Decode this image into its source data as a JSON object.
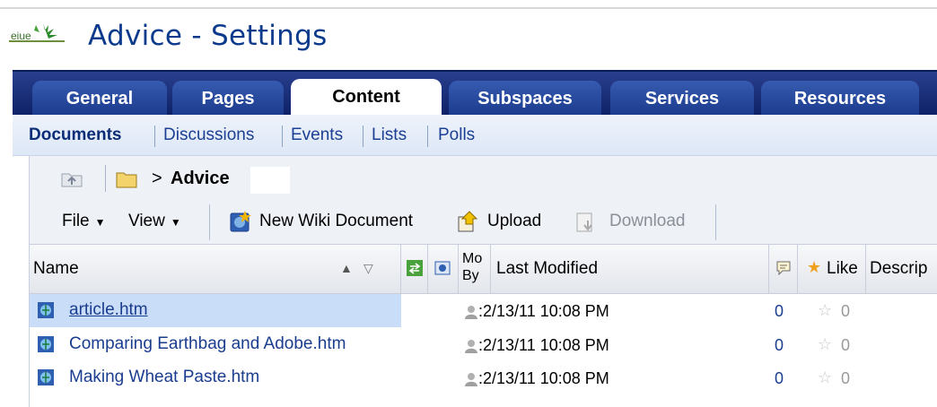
{
  "header": {
    "title": "Advice - Settings"
  },
  "tabs": [
    {
      "label": "General"
    },
    {
      "label": "Pages"
    },
    {
      "label": "Content"
    },
    {
      "label": "Subspaces"
    },
    {
      "label": "Services"
    },
    {
      "label": "Resources"
    }
  ],
  "active_tab": "Content",
  "subtabs": [
    {
      "label": "Documents"
    },
    {
      "label": "Discussions"
    },
    {
      "label": "Events"
    },
    {
      "label": "Lists"
    },
    {
      "label": "Polls"
    }
  ],
  "active_subtab": "Documents",
  "breadcrumb": {
    "separator": ">",
    "current": "Advice"
  },
  "toolbar": {
    "file_label": "File",
    "view_label": "View",
    "new_wiki_label": "New Wiki Document",
    "upload_label": "Upload",
    "download_label": "Download"
  },
  "table": {
    "columns": {
      "name": "Name",
      "modified_by": "Mo By",
      "modified_by_line1": "Mo",
      "modified_by_line2": "By",
      "last_modified": "Last Modified",
      "like": "Like",
      "description": "Descrip"
    },
    "rows": [
      {
        "name": "article.htm",
        "modified": ":2/13/11 10:08 PM",
        "comments": "0",
        "likes": "0"
      },
      {
        "name": "Comparing Earthbag and Adobe.htm",
        "modified": ":2/13/11 10:08 PM",
        "comments": "0",
        "likes": "0"
      },
      {
        "name": "Making Wheat Paste.htm",
        "modified": ":2/13/11 10:08 PM",
        "comments": "0",
        "likes": "0"
      }
    ]
  },
  "colors": {
    "title": "#0b3a8c",
    "tab_bar": "#0d2267",
    "link": "#1a3d8f",
    "selection": "#c9dcf8"
  }
}
